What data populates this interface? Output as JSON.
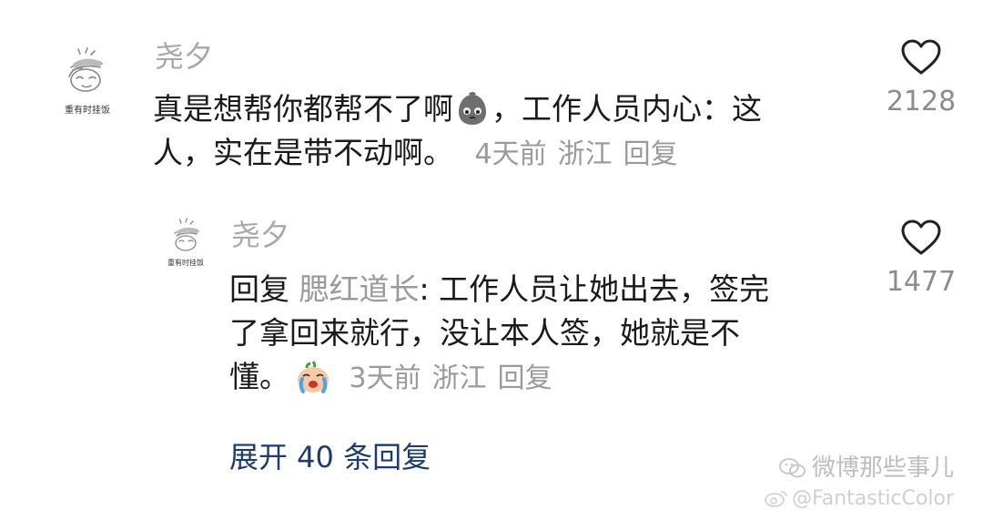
{
  "comments": [
    {
      "username": "尧夕",
      "avatar_caption": "重有时挂饭",
      "text_line1_a": "真是想帮你都帮不了啊",
      "text_line1_b": "，工作人员内心：这",
      "text_line2": "人，实在是带不动啊。",
      "inline_emoji": "grey-sad-blob-icon",
      "meta": {
        "time": "4天前",
        "location": "浙江",
        "reply_label": "回复"
      },
      "likes": "2128"
    }
  ],
  "reply": {
    "username": "尧夕",
    "avatar_caption": "重有时挂饭",
    "reply_word": "回复",
    "reply_to": "腮红道长",
    "text_line1": ": 工作人员让她出去，签完",
    "text_line2": "了拿回来就行，没让本人签，她就是不",
    "text_line3": "懂。",
    "inline_emoji": "crying-face-icon",
    "meta": {
      "time": "3天前",
      "location": "浙江",
      "reply_label": "回复"
    },
    "likes": "1477"
  },
  "expand_label": "展开 40 条回复",
  "watermark": {
    "line1": "微博那些事儿",
    "line2": "@FantasticColor"
  },
  "colors": {
    "username": "#a8a8a8",
    "text": "#1a1a1a",
    "meta": "#9a9a9a",
    "link": "#1d3b6e"
  }
}
